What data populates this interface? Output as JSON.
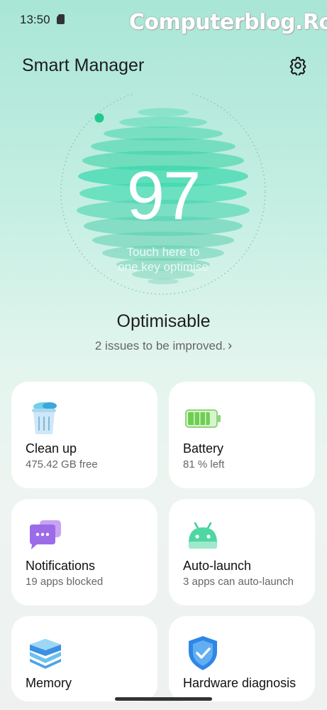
{
  "status_bar": {
    "time": "13:50",
    "watermark": "Computerblog.Ro"
  },
  "header": {
    "title": "Smart Manager"
  },
  "score": {
    "value": "97",
    "hint_line1": "Touch here to",
    "hint_line2": "one key optimise"
  },
  "status": {
    "title": "Optimisable",
    "issues": "2 issues to be improved."
  },
  "cards": [
    {
      "title": "Clean up",
      "subtitle": "475.42 GB free",
      "icon": "trash-bin-icon"
    },
    {
      "title": "Battery",
      "subtitle": "81 % left",
      "icon": "battery-icon"
    },
    {
      "title": "Notifications",
      "subtitle": "19 apps blocked",
      "icon": "chat-bubbles-icon"
    },
    {
      "title": "Auto-launch",
      "subtitle": "3 apps can auto-launch",
      "icon": "android-robot-icon"
    },
    {
      "title": "Memory",
      "subtitle": "",
      "icon": "memory-layers-icon"
    },
    {
      "title": "Hardware diagnosis",
      "subtitle": "",
      "icon": "shield-check-icon"
    }
  ],
  "colors": {
    "accent": "#2fd6a8",
    "background_top": "#a9e6d6",
    "card": "#ffffff"
  },
  "battery_level": 0.81
}
